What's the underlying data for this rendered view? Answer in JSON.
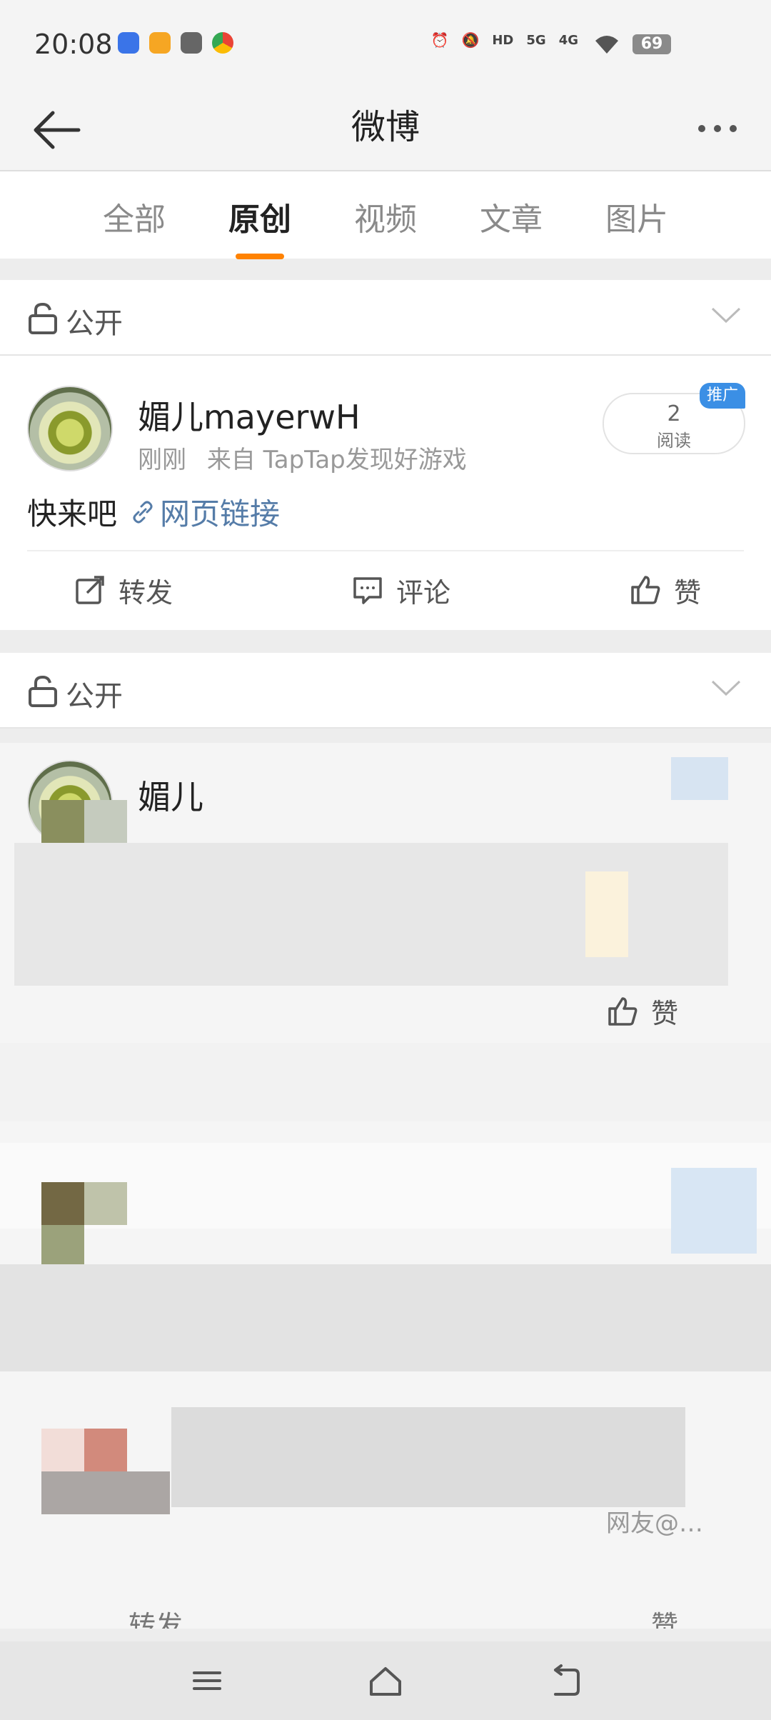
{
  "status_bar": {
    "time": "20:08",
    "battery": "69",
    "signal_labels": [
      "5G",
      "4G"
    ],
    "icons": [
      "baidu-icon",
      "weibo-icon",
      "app-icon",
      "chrome-icon",
      "alarm-icon",
      "mute-icon",
      "hd-icon",
      "signal-icon",
      "wifi-icon",
      "battery-icon"
    ]
  },
  "header": {
    "title": "微博"
  },
  "tabs": [
    {
      "label": "全部"
    },
    {
      "label": "原创",
      "active": true
    },
    {
      "label": "视频"
    },
    {
      "label": "文章"
    },
    {
      "label": "图片"
    }
  ],
  "cards": [
    {
      "visibility": "公开",
      "user": "媚儿mayerwH",
      "time": "刚刚",
      "source": "来自 TapTap发现好游戏",
      "reads": "2",
      "reads_label": "阅读",
      "promo": "推广",
      "text": "快来吧",
      "link_text": "网页链接",
      "actions": {
        "repost": "转发",
        "comment": "评论",
        "like": "赞"
      }
    },
    {
      "visibility": "公开",
      "user": "媚儿",
      "actions": {
        "like": "赞"
      }
    }
  ],
  "partial_texts": {
    "mention": "网友@…",
    "repost": "转发",
    "like": "赞"
  },
  "accent": "#ff8200"
}
